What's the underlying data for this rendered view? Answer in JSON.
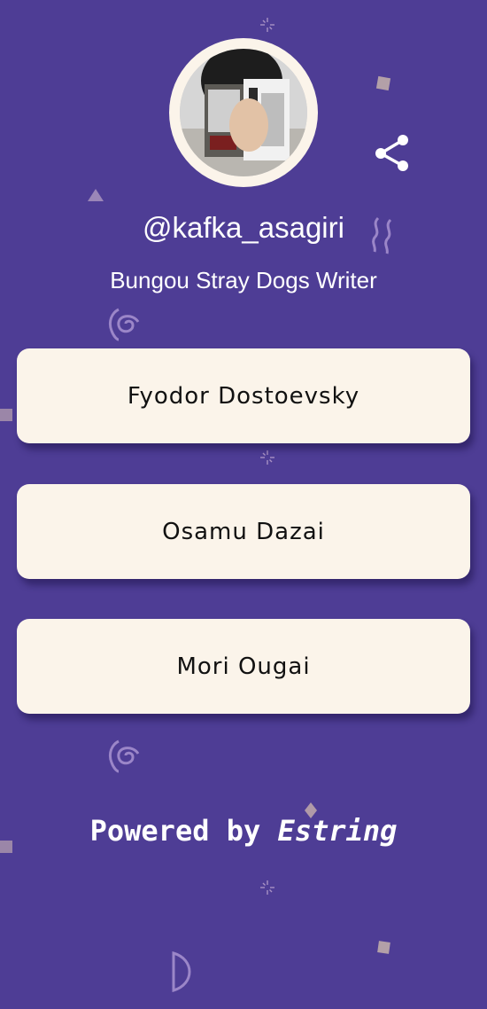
{
  "profile": {
    "handle": "@kafka_asagiri",
    "bio": "Bungou Stray Dogs Writer",
    "avatar_alt": "avatar"
  },
  "actions": {
    "share_icon": "share-icon"
  },
  "links": [
    {
      "label": "Fyodor Dostoevsky"
    },
    {
      "label": "Osamu Dazai"
    },
    {
      "label": "Mori Ougai"
    }
  ],
  "footer": {
    "prefix": "Powered by",
    "brand": "Estring"
  },
  "colors": {
    "background": "#4e3d95",
    "card": "#fbf4ea",
    "text": "#ffffff",
    "deco": "#a891c4"
  }
}
